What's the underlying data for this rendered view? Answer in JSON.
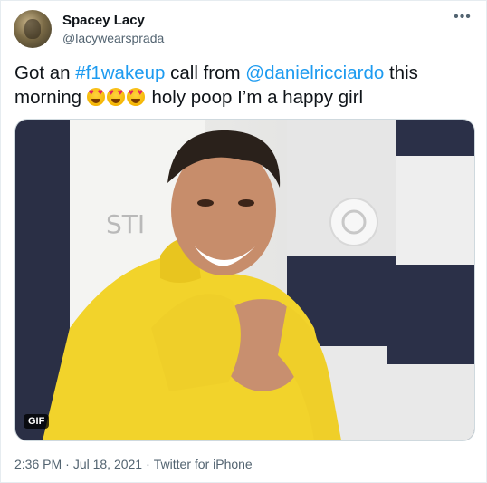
{
  "author": {
    "name": "Spacey Lacy",
    "handle": "@lacywearsprada"
  },
  "tweet": {
    "text_part1": "Got an ",
    "hashtag": "#f1wakeup",
    "text_part2": " call from ",
    "mention": "@danielricciardo",
    "text_part3": " this morning ",
    "emojis": [
      "smiling-face-with-heart-eyes",
      "smiling-face-with-heart-eyes",
      "smiling-face-with-heart-eyes"
    ],
    "text_part4": " holy poop I’m a happy girl"
  },
  "media": {
    "badge": "GIF",
    "background_text": "STI"
  },
  "meta": {
    "time": "2:36 PM",
    "separator": "·",
    "date": "Jul 18, 2021",
    "source": "Twitter for iPhone"
  },
  "colors": {
    "link": "#1d9bf0",
    "secondary_text": "#536471",
    "hoodie": "#f2d32b"
  }
}
